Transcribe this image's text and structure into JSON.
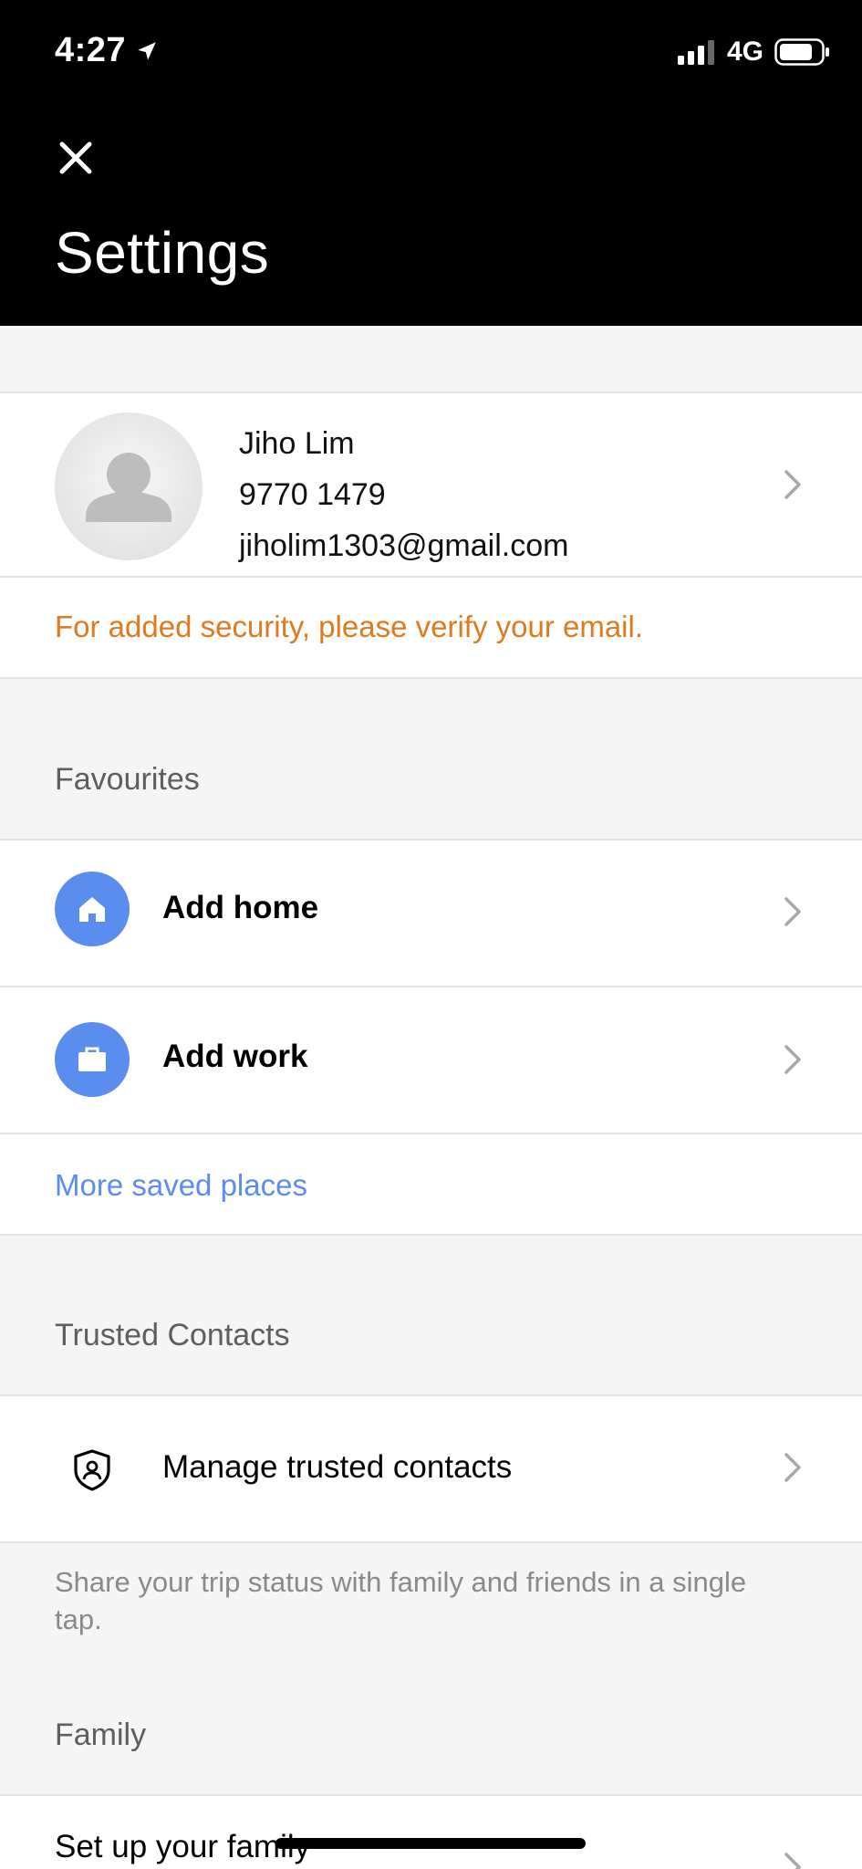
{
  "status_bar": {
    "time": "4:27",
    "network": "4G"
  },
  "header": {
    "title": "Settings"
  },
  "profile": {
    "name": "Jiho Lim",
    "phone": "9770 1479",
    "email": "jiholim1303@gmail.com",
    "verify_notice": "For added security, please verify your email."
  },
  "favourites": {
    "label": "Favourites",
    "items": [
      {
        "label": "Add home",
        "icon": "home-icon"
      },
      {
        "label": "Add work",
        "icon": "briefcase-icon"
      }
    ],
    "more_link": "More saved places"
  },
  "trusted_contacts": {
    "label": "Trusted Contacts",
    "manage_label": "Manage trusted contacts",
    "description": "Share your trip status with family and friends in a single tap."
  },
  "family": {
    "label": "Family",
    "setup_label": "Set up your family"
  },
  "colors": {
    "accent_blue": "#5b8def",
    "warning_orange": "#e07a1f",
    "header_bg": "#000000"
  }
}
